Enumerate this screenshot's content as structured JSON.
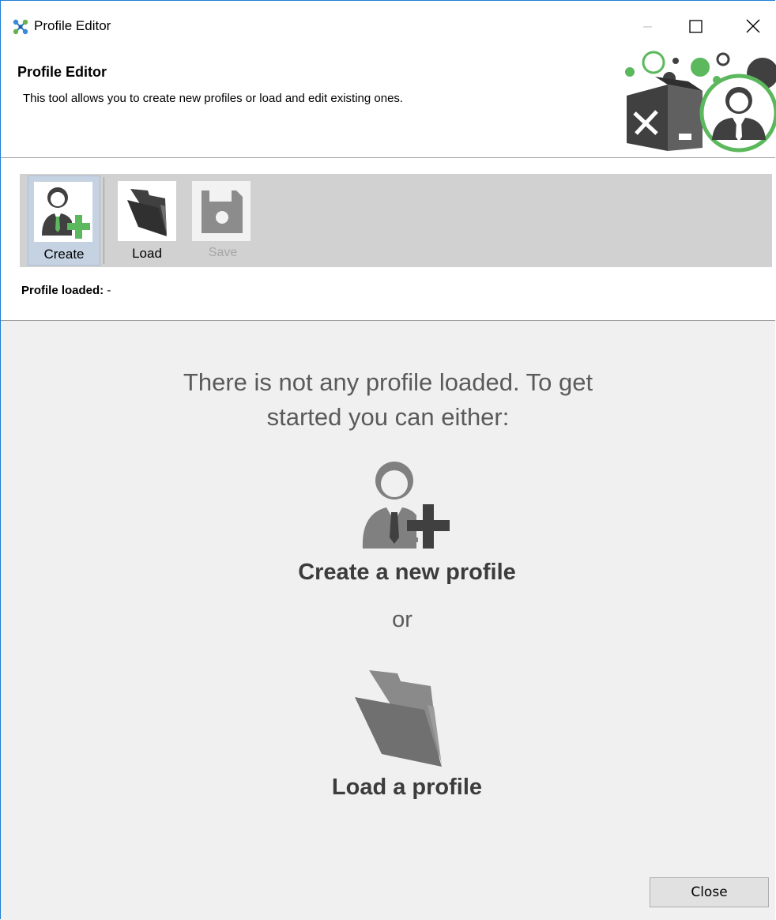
{
  "window": {
    "title": "Profile Editor"
  },
  "header": {
    "title": "Profile Editor",
    "description": "This tool allows you to create new profiles or load and edit existing ones."
  },
  "toolbar": {
    "create_label": "Create",
    "load_label": "Load",
    "save_label": "Save"
  },
  "status": {
    "profile_loaded_label": "Profile loaded:",
    "profile_loaded_value": "-"
  },
  "main": {
    "intro": "There is not any profile loaded. To get started you can either:",
    "create_link": "Create a new profile",
    "or_text": "or",
    "load_link": "Load a profile"
  },
  "footer": {
    "close_label": "Close"
  },
  "icons": {
    "app": "network-nodes-icon",
    "create": "user-add-icon",
    "load": "folder-icon",
    "save": "floppy-disk-icon",
    "header_art": "profile-editor-banner-icon"
  },
  "colors": {
    "accent_green": "#5cb85c",
    "icon_dark": "#404040",
    "icon_gray": "#808080",
    "toolbar_bg": "#d1d1d1",
    "selected_bg": "#c4d2e2",
    "main_bg": "#f0f0f0"
  }
}
